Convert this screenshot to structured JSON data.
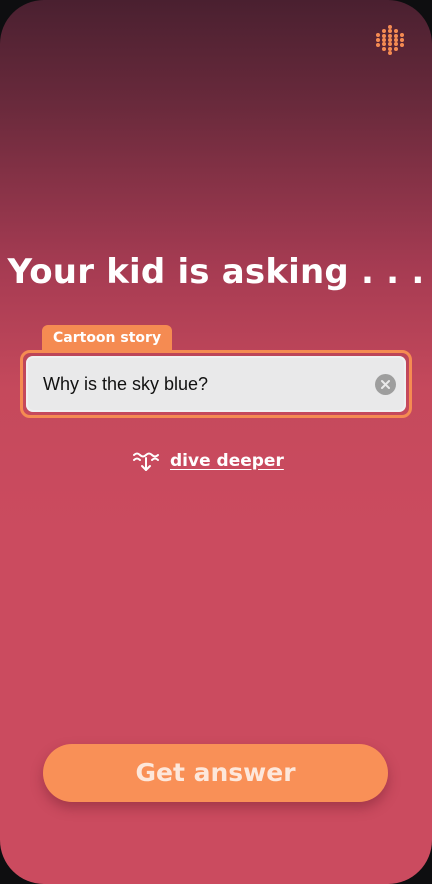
{
  "header": {
    "menu_icon": "dots-grid-icon"
  },
  "main": {
    "title": "Your kid is asking . . .",
    "mode_tab": "Cartoon story",
    "question_value": "Why is the sky blue?",
    "clear_icon": "clear-circle-icon",
    "dive_icon": "dive-down-icon",
    "dive_label": "dive deeper",
    "cta_label": "Get answer"
  },
  "colors": {
    "accent": "#f58b52",
    "background_top": "#4a2030",
    "background_main": "#cb4b5f",
    "field_background": "#e9e9ea"
  }
}
